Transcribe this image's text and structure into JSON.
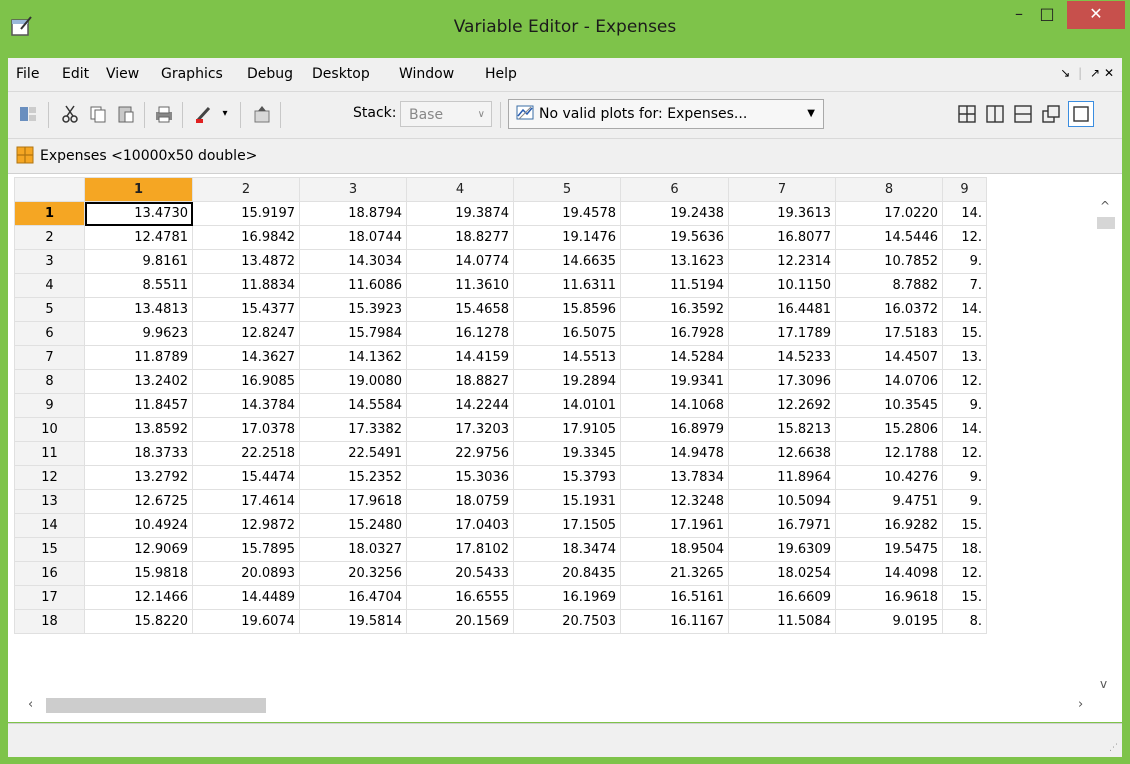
{
  "window": {
    "title": "Variable Editor - Expenses",
    "minimize": "–",
    "maximize": "□",
    "close": "✕"
  },
  "menu": {
    "items": [
      "File",
      "Edit",
      "View",
      "Graphics",
      "Debug",
      "Desktop",
      "Window",
      "Help"
    ],
    "undock": "↘",
    "dock_arrow": "↗",
    "close": "✕"
  },
  "toolbar": {
    "stack_label": "Stack:",
    "stack_value": "Base",
    "plot_label": "No valid plots for: Expenses...",
    "icons": [
      "new-variable-icon",
      "cut-icon",
      "copy-icon",
      "paste-icon",
      "print-icon",
      "brush-icon",
      "up-folder-icon"
    ]
  },
  "variable": {
    "label": "Expenses <10000x50 double>"
  },
  "grid": {
    "columns": [
      "1",
      "2",
      "3",
      "4",
      "5",
      "6",
      "7",
      "8",
      "9"
    ],
    "rows": [
      {
        "n": "1",
        "v": [
          "13.4730",
          "15.9197",
          "18.8794",
          "19.3874",
          "19.4578",
          "19.2438",
          "19.3613",
          "17.0220",
          "14."
        ]
      },
      {
        "n": "2",
        "v": [
          "12.4781",
          "16.9842",
          "18.0744",
          "18.8277",
          "19.1476",
          "19.5636",
          "16.8077",
          "14.5446",
          "12."
        ]
      },
      {
        "n": "3",
        "v": [
          "9.8161",
          "13.4872",
          "14.3034",
          "14.0774",
          "14.6635",
          "13.1623",
          "12.2314",
          "10.7852",
          "9."
        ]
      },
      {
        "n": "4",
        "v": [
          "8.5511",
          "11.8834",
          "11.6086",
          "11.3610",
          "11.6311",
          "11.5194",
          "10.1150",
          "8.7882",
          "7."
        ]
      },
      {
        "n": "5",
        "v": [
          "13.4813",
          "15.4377",
          "15.3923",
          "15.4658",
          "15.8596",
          "16.3592",
          "16.4481",
          "16.0372",
          "14."
        ]
      },
      {
        "n": "6",
        "v": [
          "9.9623",
          "12.8247",
          "15.7984",
          "16.1278",
          "16.5075",
          "16.7928",
          "17.1789",
          "17.5183",
          "15."
        ]
      },
      {
        "n": "7",
        "v": [
          "11.8789",
          "14.3627",
          "14.1362",
          "14.4159",
          "14.5513",
          "14.5284",
          "14.5233",
          "14.4507",
          "13."
        ]
      },
      {
        "n": "8",
        "v": [
          "13.2402",
          "16.9085",
          "19.0080",
          "18.8827",
          "19.2894",
          "19.9341",
          "17.3096",
          "14.0706",
          "12."
        ]
      },
      {
        "n": "9",
        "v": [
          "11.8457",
          "14.3784",
          "14.5584",
          "14.2244",
          "14.0101",
          "14.1068",
          "12.2692",
          "10.3545",
          "9."
        ]
      },
      {
        "n": "10",
        "v": [
          "13.8592",
          "17.0378",
          "17.3382",
          "17.3203",
          "17.9105",
          "16.8979",
          "15.8213",
          "15.2806",
          "14."
        ]
      },
      {
        "n": "11",
        "v": [
          "18.3733",
          "22.2518",
          "22.5491",
          "22.9756",
          "19.3345",
          "14.9478",
          "12.6638",
          "12.1788",
          "12."
        ]
      },
      {
        "n": "12",
        "v": [
          "13.2792",
          "15.4474",
          "15.2352",
          "15.3036",
          "15.3793",
          "13.7834",
          "11.8964",
          "10.4276",
          "9."
        ]
      },
      {
        "n": "13",
        "v": [
          "12.6725",
          "17.4614",
          "17.9618",
          "18.0759",
          "15.1931",
          "12.3248",
          "10.5094",
          "9.4751",
          "9."
        ]
      },
      {
        "n": "14",
        "v": [
          "10.4924",
          "12.9872",
          "15.2480",
          "17.0403",
          "17.1505",
          "17.1961",
          "16.7971",
          "16.9282",
          "15."
        ]
      },
      {
        "n": "15",
        "v": [
          "12.9069",
          "15.7895",
          "18.0327",
          "17.8102",
          "18.3474",
          "18.9504",
          "19.6309",
          "19.5475",
          "18."
        ]
      },
      {
        "n": "16",
        "v": [
          "15.9818",
          "20.0893",
          "20.3256",
          "20.5433",
          "20.8435",
          "21.3265",
          "18.0254",
          "14.4098",
          "12."
        ]
      },
      {
        "n": "17",
        "v": [
          "12.1466",
          "14.4489",
          "16.4704",
          "16.6555",
          "16.1969",
          "16.5161",
          "16.6609",
          "16.9618",
          "15."
        ]
      },
      {
        "n": "18",
        "v": [
          "15.8220",
          "19.6074",
          "19.5814",
          "20.1569",
          "20.7503",
          "16.1167",
          "11.5084",
          "9.0195",
          "8."
        ]
      }
    ]
  },
  "scroll": {
    "left": "‹",
    "right": "›",
    "up": "^",
    "down": "v"
  },
  "colors": {
    "titlebar": "#7ec34a",
    "close": "#c7504c",
    "selected_header": "#f5a623"
  }
}
